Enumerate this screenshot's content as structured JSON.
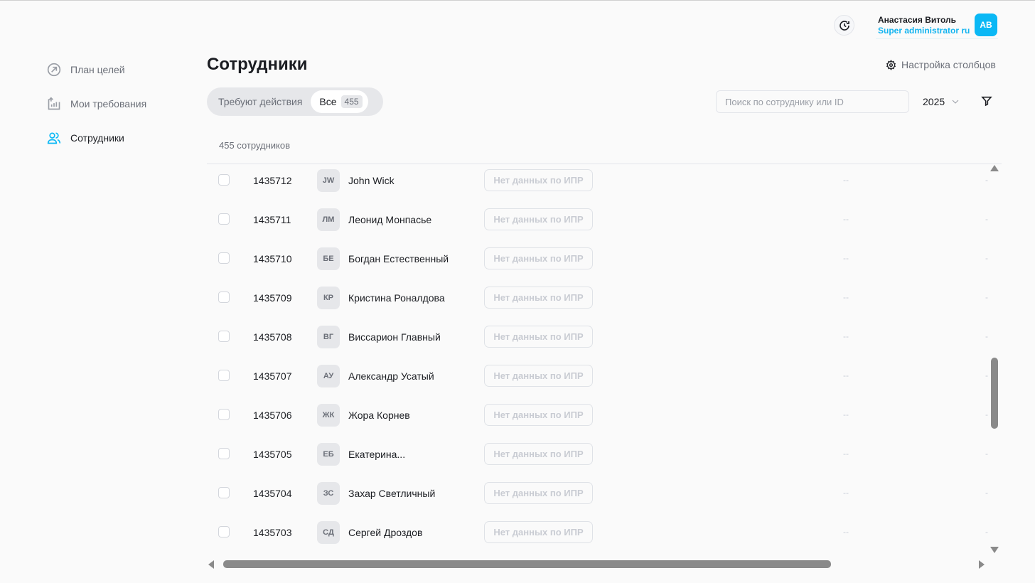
{
  "header": {
    "user_name": "Анастасия Витоль",
    "user_role": "Super administrator ru",
    "avatar_initials": "АВ"
  },
  "sidebar": {
    "items": [
      {
        "label": "План целей",
        "icon": "goal-arrow-icon"
      },
      {
        "label": "Мои требования",
        "icon": "chart-upload-icon"
      },
      {
        "label": "Сотрудники",
        "icon": "users-icon",
        "active": true
      }
    ]
  },
  "main": {
    "title": "Сотрудники",
    "column_settings": "Настройка столбцов",
    "tabs": [
      {
        "label": "Требуют действия"
      },
      {
        "label": "Все",
        "count": "455"
      }
    ],
    "search_placeholder": "Поиск по сотруднику или ID",
    "year": "2025",
    "total": "455 сотрудников",
    "ipr_label": "Нет данных по ИПР",
    "empty1": "--",
    "empty2": "-",
    "rows": [
      {
        "id": "1435712",
        "initials": "JW",
        "name": "John Wick"
      },
      {
        "id": "1435711",
        "initials": "ЛМ",
        "name": "Леонид Монпасье"
      },
      {
        "id": "1435710",
        "initials": "БЕ",
        "name": "Богдан Естественный"
      },
      {
        "id": "1435709",
        "initials": "КР",
        "name": "Кристина Роналдова"
      },
      {
        "id": "1435708",
        "initials": "ВГ",
        "name": "Виссарион Главный"
      },
      {
        "id": "1435707",
        "initials": "АУ",
        "name": "Александр Усатый"
      },
      {
        "id": "1435706",
        "initials": "ЖК",
        "name": "Жора Корнев"
      },
      {
        "id": "1435705",
        "initials": "ЕБ",
        "name": "Екатерина..."
      },
      {
        "id": "1435704",
        "initials": "ЗС",
        "name": "Захар Светличный"
      },
      {
        "id": "1435703",
        "initials": "СД",
        "name": "Сергей Дроздов"
      }
    ]
  },
  "colors": {
    "accent": "#0ab8f5"
  }
}
